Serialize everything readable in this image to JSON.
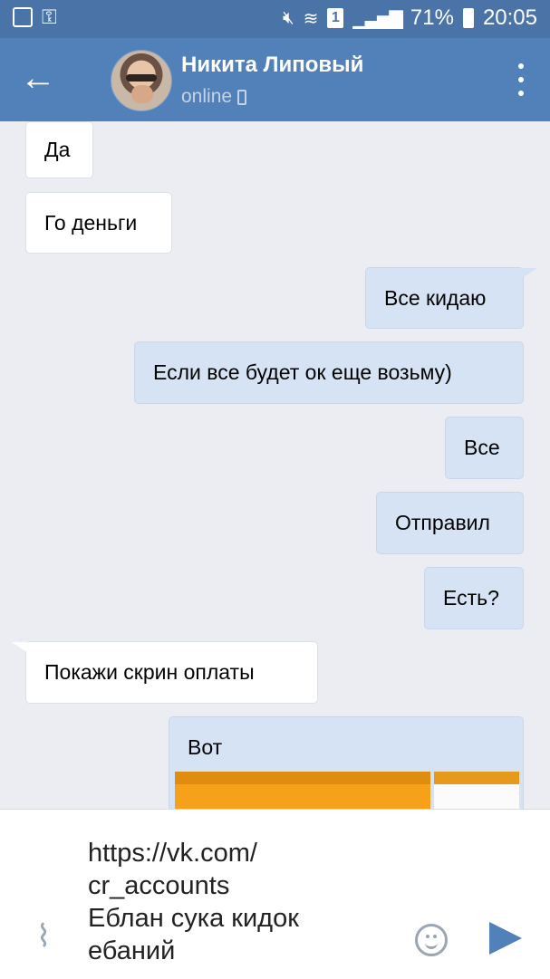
{
  "status_bar": {
    "battery_percent": "71%",
    "time": "20:05",
    "sim_badge": "1",
    "icons": [
      "image-icon",
      "key-icon",
      "mute-icon",
      "wifi-icon",
      "sim-icon",
      "signal-icon",
      "battery-icon"
    ]
  },
  "header": {
    "back_icon": "arrow-left-icon",
    "contact_name": "Никита Липовый",
    "status": "online",
    "menu_icon": "more-vert-icon"
  },
  "messages": [
    {
      "direction": "in",
      "text": "Да"
    },
    {
      "direction": "in",
      "text": "Го деньги"
    },
    {
      "direction": "out",
      "text": "Все кидаю"
    },
    {
      "direction": "out",
      "text": "Если все будет ок еще возьму)"
    },
    {
      "direction": "out",
      "text": "Все"
    },
    {
      "direction": "out",
      "text": "Отправил"
    },
    {
      "direction": "out",
      "text": "Есть?"
    },
    {
      "direction": "in",
      "text": "Покажи скрин оплаты"
    },
    {
      "direction": "out",
      "text": "Вот",
      "has_photos": true
    }
  ],
  "composer": {
    "text": "https://vk.com/\ncr_accounts\nЕблан сука кидок\nебаний",
    "attach_icon": "paperclip-icon",
    "emoji_icon": "smiley-icon",
    "send_icon": "send-icon"
  },
  "colors": {
    "header": "#5181b8",
    "statusbar": "#4a74a8",
    "background": "#ecedf2",
    "outgoing_bubble": "#d5e3f4",
    "incoming_bubble": "#ffffff"
  }
}
